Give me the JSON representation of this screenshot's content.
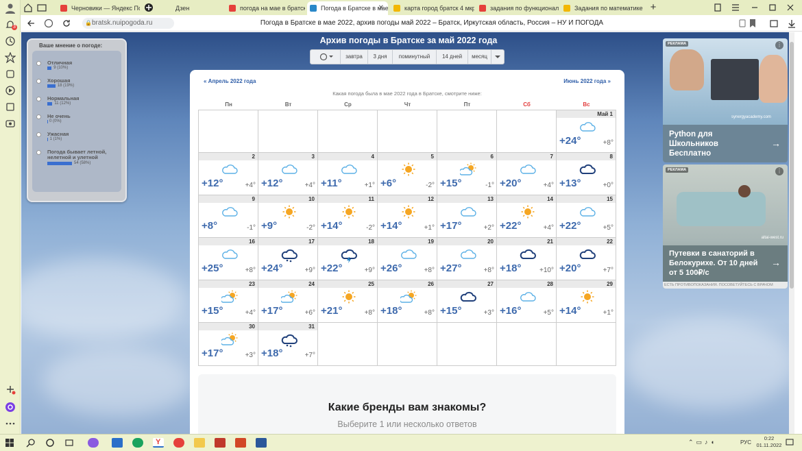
{
  "tabs": [
    {
      "label": "Черновики — Яндекс Почта",
      "color": "#e5413b"
    },
    {
      "label": "Дзен",
      "color": "#222"
    },
    {
      "label": "погода на мае в братске",
      "color": "#e5413b"
    },
    {
      "label": "Погода в Братске в мае 2022",
      "color": "#2a88c8",
      "active": true
    },
    {
      "label": "карта город братск 4 мкр",
      "color": "#f2b705"
    },
    {
      "label": "задания по функциональной",
      "color": "#e5413b"
    },
    {
      "label": "Задания по математике д",
      "color": "#f2b705"
    }
  ],
  "address": {
    "url": "bratsk.nuipogoda.ru",
    "page_title": "Погода в Братске в мае 2022, архив погоды май 2022 – Братск, Иркутская область, Россия – НУ И ПОГОДА"
  },
  "sidebar_badge": "3",
  "opinion": {
    "title": "Ваше мнение о погоде:",
    "options": [
      {
        "label": "Отличная",
        "count": "9 (10%)",
        "pct": 10
      },
      {
        "label": "Хорошая",
        "count": "18 (19%)",
        "pct": 19
      },
      {
        "label": "Нормальная",
        "count": "11 (12%)",
        "pct": 12
      },
      {
        "label": "Не очень",
        "count": "0 (0%)",
        "pct": 0
      },
      {
        "label": "Ужасная",
        "count": "1 (1%)",
        "pct": 1
      },
      {
        "label": "Погода бывает летной, нелетной и улетной",
        "count": "54 (58%)",
        "pct": 58
      }
    ]
  },
  "header": {
    "title": "Архив погоды в Братске за май 2022 года",
    "nav": [
      "завтра",
      "3 дня",
      "поминутный",
      "14 дней",
      "месяц"
    ]
  },
  "calendar": {
    "prev": "« Апрель 2022 года",
    "next": "Июнь 2022 года »",
    "subtitle": "Какая погода была в мае 2022 года в Братске, смотрите ниже:",
    "dow": [
      "Пн",
      "Вт",
      "Ср",
      "Чт",
      "Пт",
      "Сб",
      "Вс"
    ],
    "days": [
      {
        "d": "Май 1",
        "hi": "+24°",
        "lo": "+8°",
        "icon": "cloud"
      },
      {
        "d": "2",
        "hi": "+12°",
        "lo": "+4°",
        "icon": "cloud"
      },
      {
        "d": "3",
        "hi": "+12°",
        "lo": "+4°",
        "icon": "cloud"
      },
      {
        "d": "4",
        "hi": "+11°",
        "lo": "+1°",
        "icon": "cloud"
      },
      {
        "d": "5",
        "hi": "+6°",
        "lo": "-2°",
        "icon": "sun"
      },
      {
        "d": "6",
        "hi": "+15°",
        "lo": "-1°",
        "icon": "suncloud"
      },
      {
        "d": "7",
        "hi": "+20°",
        "lo": "+4°",
        "icon": "cloud"
      },
      {
        "d": "8",
        "hi": "+13°",
        "lo": "+0°",
        "icon": "darkcloud"
      },
      {
        "d": "9",
        "hi": "+8°",
        "lo": "-1°",
        "icon": "cloud"
      },
      {
        "d": "10",
        "hi": "+9°",
        "lo": "-2°",
        "icon": "sun"
      },
      {
        "d": "11",
        "hi": "+14°",
        "lo": "-2°",
        "icon": "sun"
      },
      {
        "d": "12",
        "hi": "+14°",
        "lo": "+1°",
        "icon": "sun"
      },
      {
        "d": "13",
        "hi": "+17°",
        "lo": "+2°",
        "icon": "cloud"
      },
      {
        "d": "14",
        "hi": "+22°",
        "lo": "+4°",
        "icon": "sun"
      },
      {
        "d": "15",
        "hi": "+22°",
        "lo": "+5°",
        "icon": "cloud"
      },
      {
        "d": "16",
        "hi": "+25°",
        "lo": "+8°",
        "icon": "cloud"
      },
      {
        "d": "17",
        "hi": "+24°",
        "lo": "+9°",
        "icon": "rain"
      },
      {
        "d": "18",
        "hi": "+22°",
        "lo": "+9°",
        "icon": "storm"
      },
      {
        "d": "19",
        "hi": "+26°",
        "lo": "+8°",
        "icon": "cloud"
      },
      {
        "d": "20",
        "hi": "+27°",
        "lo": "+8°",
        "icon": "cloud"
      },
      {
        "d": "21",
        "hi": "+18°",
        "lo": "+10°",
        "icon": "darkcloud"
      },
      {
        "d": "22",
        "hi": "+20°",
        "lo": "+7°",
        "icon": "darkcloud"
      },
      {
        "d": "23",
        "hi": "+15°",
        "lo": "+4°",
        "icon": "suncloud"
      },
      {
        "d": "24",
        "hi": "+17°",
        "lo": "+6°",
        "icon": "suncloud"
      },
      {
        "d": "25",
        "hi": "+21°",
        "lo": "+8°",
        "icon": "sun"
      },
      {
        "d": "26",
        "hi": "+18°",
        "lo": "+8°",
        "icon": "suncloud"
      },
      {
        "d": "27",
        "hi": "+15°",
        "lo": "+3°",
        "icon": "darkcloud"
      },
      {
        "d": "28",
        "hi": "+16°",
        "lo": "+5°",
        "icon": "cloud"
      },
      {
        "d": "29",
        "hi": "+14°",
        "lo": "+1°",
        "icon": "sun"
      },
      {
        "d": "30",
        "hi": "+17°",
        "lo": "+3°",
        "icon": "suncloud"
      },
      {
        "d": "31",
        "hi": "+18°",
        "lo": "+7°",
        "icon": "rain"
      }
    ]
  },
  "brand": {
    "title": "Какие бренды вам знакомы?",
    "subtitle": "Выберите 1 или несколько ответов"
  },
  "ads": [
    {
      "label": "РЕКЛАМА",
      "text": "Python для Школьников Бесплатно",
      "site": "synergyacademy.com"
    },
    {
      "label": "РЕКЛАМА",
      "text": "Путевки в санаторий в Белокурихе. От 10 дней от 5 100₽/с",
      "site": "altai-west.ru",
      "disclaimer": "ЕСТЬ ПРОТИВОПОКАЗАНИЯ. ПОСОВЕТУЙТЕСЬ С ВРАЧОМ"
    }
  ],
  "tray": {
    "lang": "РУС",
    "time": "0:22",
    "date": "01.11.2022"
  }
}
